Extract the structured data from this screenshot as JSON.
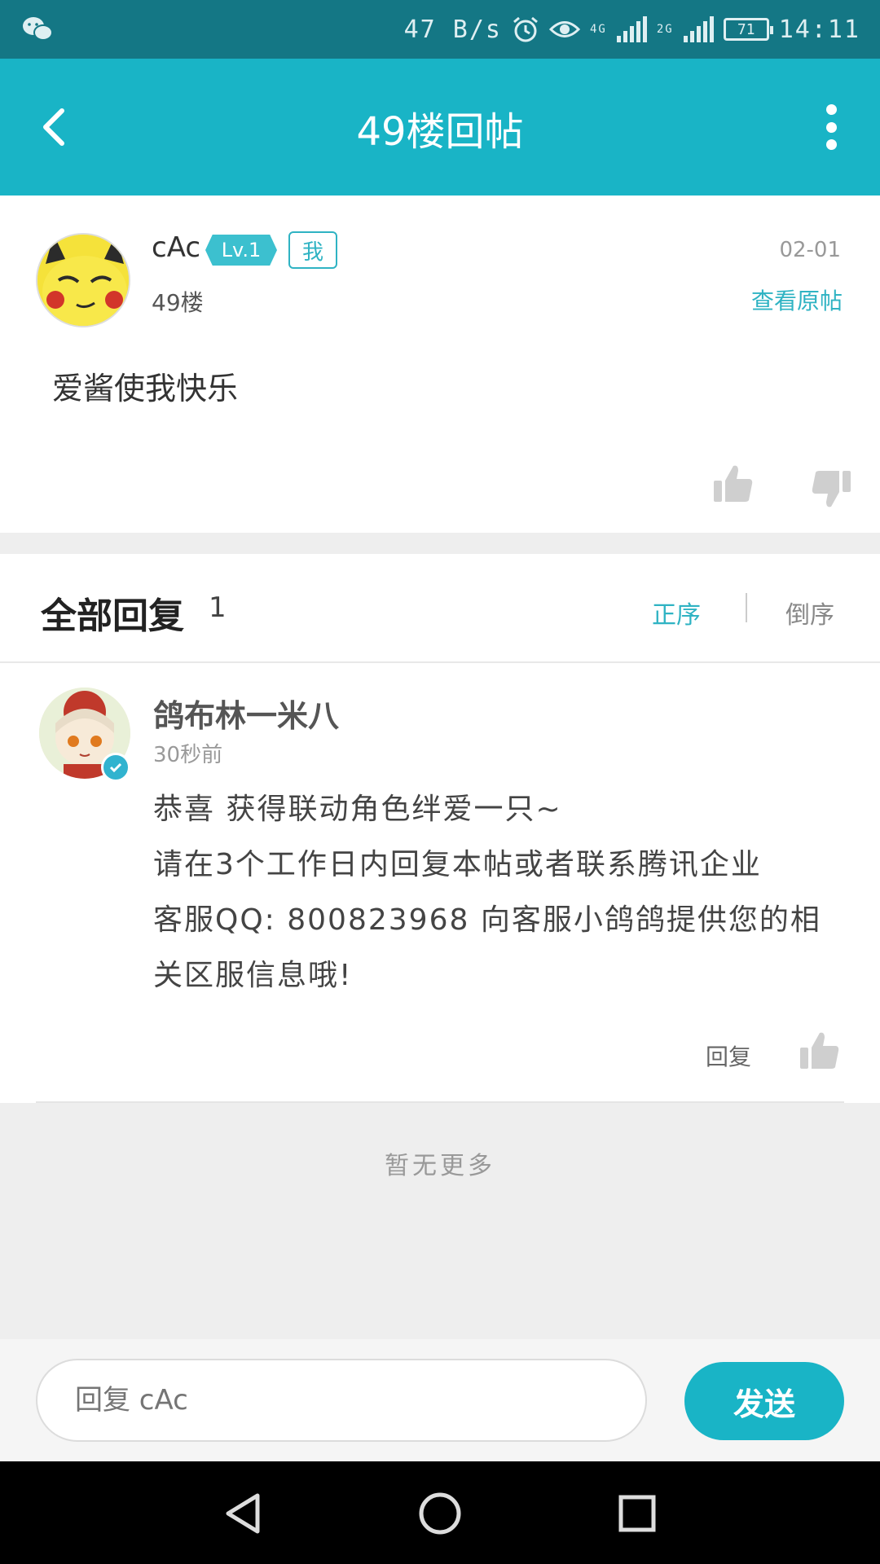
{
  "status_bar": {
    "speed": "47 B/s",
    "net1": "4G",
    "net2": "2G",
    "battery": "71",
    "time": "14:11"
  },
  "app_bar": {
    "title": "49楼回帖"
  },
  "post": {
    "username": "cAc",
    "level": "Lv.1",
    "me_badge": "我",
    "floor": "49楼",
    "date": "02-01",
    "view_original": "查看原帖",
    "content": "爱酱使我快乐"
  },
  "replies_header": {
    "label": "全部回复",
    "count": "1",
    "order_asc": "正序",
    "order_desc": "倒序"
  },
  "reply": {
    "name": "鸽布林一米八",
    "time": "30秒前",
    "lines": [
      "恭喜 获得联动角色绊爱一只~",
      "请在3个工作日内回复本帖或者联系腾讯企业",
      "客服QQ: 800823968 向客服小鸽鸽提供您的相",
      "关区服信息哦!"
    ],
    "reply_label": "回复"
  },
  "no_more": "暂无更多",
  "composer": {
    "placeholder": "回复 cAc",
    "send": "发送"
  },
  "colors": {
    "accent": "#19b4c6",
    "status_bar": "#147785"
  }
}
